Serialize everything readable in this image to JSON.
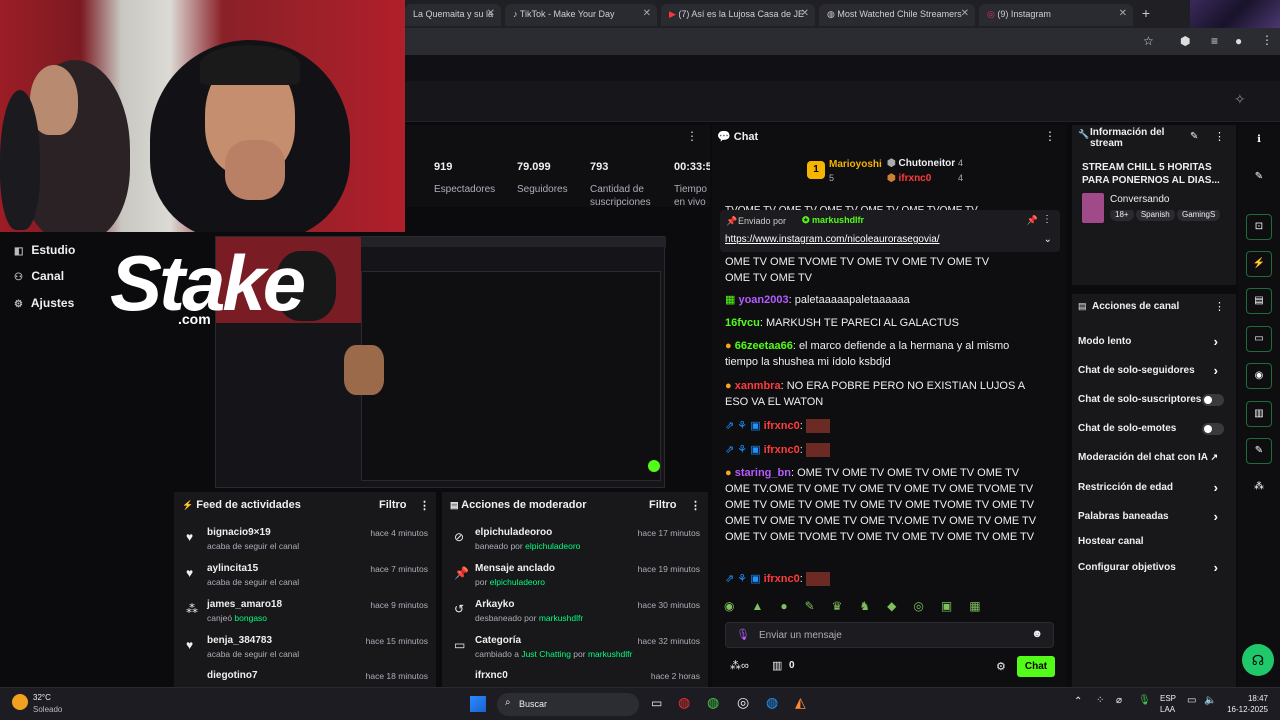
{
  "browser": {
    "tabs": [
      {
        "label": "La Quemaita y su la"
      },
      {
        "label": "TikTok - Make Your Day"
      },
      {
        "label": "(7) Así es la Lujosa Casa de JE"
      },
      {
        "label": "Most Watched Chile Streamers"
      },
      {
        "label": "(9) Instagram"
      }
    ]
  },
  "sidebar": {
    "items": [
      {
        "label": "Estudio"
      },
      {
        "label": "Canal"
      },
      {
        "label": "Ajustes"
      }
    ]
  },
  "overlay": {
    "brand": "Stake",
    "brand_sub": ".com"
  },
  "stats": {
    "items": [
      {
        "value": "919",
        "label": "Espectadores"
      },
      {
        "value": "79.099",
        "label": "Seguidores"
      },
      {
        "value": "793",
        "label": "Cantidad de suscripciones"
      },
      {
        "value": "00:33:5",
        "label": "Tiempo en vivo"
      }
    ]
  },
  "feed": {
    "title": "Feed de actividades",
    "filter": "Filtro",
    "rows": [
      {
        "name": "bignacio9×19",
        "sub": "acaba de seguir el canal",
        "time": "hace 4 minutos"
      },
      {
        "name": "aylincita15",
        "sub": "acaba de seguir el canal",
        "time": "hace 7 minutos"
      },
      {
        "name": "james_amaro18",
        "sub": "canjeó bongaso",
        "time": "hace 9 minutos"
      },
      {
        "name": "benja_384783",
        "sub": "acaba de seguir el canal",
        "time": "hace 15 minutos"
      },
      {
        "name": "diegotino7",
        "sub": "",
        "time": "hace 18 minutos"
      }
    ]
  },
  "mod": {
    "title": "Acciones de moderador",
    "filter": "Filtro",
    "rows": [
      {
        "name": "elpichuladeoroo",
        "sub": "baneado por elpichuladeoro",
        "time": "hace 17 minutos"
      },
      {
        "name": "Mensaje anclado",
        "sub": "por elpichuladeoro",
        "time": "hace 19 minutos"
      },
      {
        "name": "Arkayko",
        "sub": "desbaneado por markushdlfr",
        "time": "hace 30 minutos"
      },
      {
        "name": "Categoría",
        "sub": "cambiado a Just Chatting por markushdlfr",
        "time": "hace 32 minutos"
      },
      {
        "name": "ifrxnc0",
        "sub": "",
        "time": "hace 2 horas"
      }
    ]
  },
  "chat": {
    "title": "Chat",
    "top_gifters": [
      {
        "name": "Marioyoshi",
        "count": "5"
      },
      {
        "name": "Chutoneitor",
        "count": "4"
      },
      {
        "name": "ifrxnc0",
        "count": "4"
      }
    ],
    "pinned": {
      "label": "Enviado por",
      "user": "markushdlfr",
      "link": "https://www.instagram.com/nicoleaurorasegovia/"
    },
    "messages": [
      {
        "user": "",
        "text": "TVOME TV OME TV OME TV OME TV OME TVOME TV"
      },
      {
        "user": "",
        "text": "OME TV OME TV"
      },
      {
        "user": "yoan2003",
        "text": "paletaaaaapaletaaaaaa"
      },
      {
        "user": "16fvcu",
        "text": "MARKUSH TE PARECI AL GALACTUS"
      },
      {
        "user": "66zeetaa66",
        "text": "el marco defiende a la hermana y al mismo tiempo la shushea mi ídolo ksbdjd"
      },
      {
        "user": "xanmbra",
        "text": "NO ERA POBRE PERO NO EXISTIAN LUJOS A ESO VA EL WATON"
      },
      {
        "user": "ifrxnc0",
        "text": ""
      },
      {
        "user": "ifrxnc0",
        "text": ""
      },
      {
        "user": "staring_bn",
        "text": "OME TV OME TV OME TV OME TV OME TV OME TV.OME TV OME TV OME TV OME TV OME TVOME TV OME TV OME TV OME TV OME TV OME TVOME TV OME TV OME TV OME TV OME TV OME TV.OME TV OME TV OME TV OME TV OME TVOME TV OME TV OME TV OME TV OME TV"
      },
      {
        "user": "ifrxnc0",
        "text": ""
      }
    ],
    "input_placeholder": "Enviar un mensaje",
    "points": "0",
    "send_label": "Chat"
  },
  "info": {
    "title": "Información del stream",
    "stream_title": "STREAM CHILL 5 HORITAS PARA PONERNOS AL DIAS...",
    "category": "Conversando",
    "tags": [
      "18+",
      "Spanish",
      "GamingS"
    ]
  },
  "acciones": {
    "title": "Acciones de canal",
    "items": [
      {
        "label": "Modo lento"
      },
      {
        "label": "Chat de solo-seguidores"
      },
      {
        "label": "Chat de solo-suscriptores"
      },
      {
        "label": "Chat de solo-emotes"
      },
      {
        "label": "Moderación del chat con IA"
      },
      {
        "label": "Restricción de edad"
      },
      {
        "label": "Palabras baneadas"
      },
      {
        "label": "Hostear canal"
      },
      {
        "label": "Configurar objetivos"
      }
    ]
  },
  "taskbar": {
    "weather_temp": "32°C",
    "weather_desc": "Soleado",
    "search": "Buscar",
    "lang": "ESP",
    "lang2": "LAA",
    "time": "18:47",
    "date": "16-12-2025"
  },
  "colors": {
    "accent": "#53fc18",
    "user_blue": "#1e90ff",
    "user_red": "#ff3b3b",
    "user_purple": "#b45cff"
  }
}
